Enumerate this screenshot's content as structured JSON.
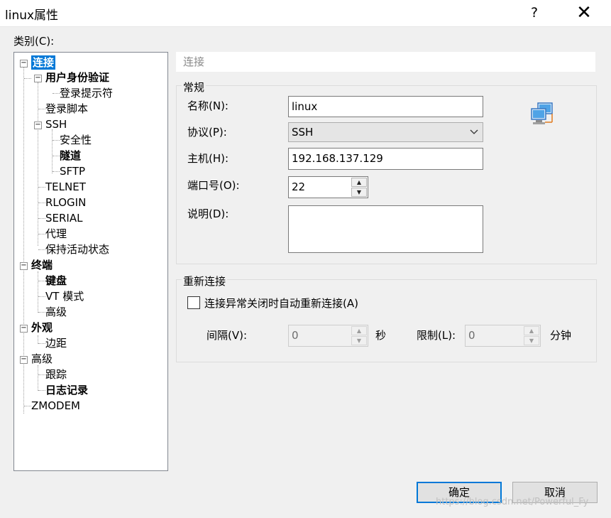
{
  "window": {
    "title": "linux属性",
    "help_glyph": "?",
    "close_glyph": "✕"
  },
  "category_label": "类别(C):",
  "tree": [
    {
      "label": "连接",
      "bold": true,
      "selected": true,
      "expander": "−"
    },
    {
      "label": "用户身份验证",
      "bold": true,
      "expander": "−"
    },
    {
      "label": "登录提示符"
    },
    {
      "label": "登录脚本"
    },
    {
      "label": "SSH",
      "expander": "−"
    },
    {
      "label": "安全性"
    },
    {
      "label": "隧道",
      "bold": true
    },
    {
      "label": "SFTP"
    },
    {
      "label": "TELNET"
    },
    {
      "label": "RLOGIN"
    },
    {
      "label": "SERIAL"
    },
    {
      "label": "代理"
    },
    {
      "label": "保持活动状态"
    },
    {
      "label": "终端",
      "bold": true,
      "expander": "−"
    },
    {
      "label": "键盘",
      "bold": true
    },
    {
      "label": "VT 模式"
    },
    {
      "label": "高级"
    },
    {
      "label": "外观",
      "bold": true,
      "expander": "−"
    },
    {
      "label": "边距"
    },
    {
      "label": "高级",
      "expander": "−"
    },
    {
      "label": "跟踪"
    },
    {
      "label": "日志记录",
      "bold": true
    },
    {
      "label": "ZMODEM"
    }
  ],
  "section_title": "连接",
  "general": {
    "group_label": "常规",
    "name_label": "名称(N):",
    "name_value": "linux",
    "protocol_label": "协议(P):",
    "protocol_value": "SSH",
    "host_label": "主机(H):",
    "host_value": "192.168.137.129",
    "port_label": "端口号(O):",
    "port_value": "22",
    "desc_label": "说明(D):"
  },
  "reconnect": {
    "group_label": "重新连接",
    "checkbox_label": "连接异常关闭时自动重新连接(A)",
    "interval_label": "间隔(V):",
    "interval_value": "0",
    "interval_unit": "秒",
    "limit_label": "限制(L):",
    "limit_value": "0",
    "limit_unit": "分钟"
  },
  "buttons": {
    "ok": "确定",
    "cancel": "取消"
  },
  "watermark": "https://blog.csdn.net/Powerful_Fy",
  "icons": {
    "network": "network-computers-icon",
    "dropdown": "chevron-down-icon"
  },
  "colors": {
    "selection": "#0078d7",
    "default_button_border": "#0078d7"
  }
}
